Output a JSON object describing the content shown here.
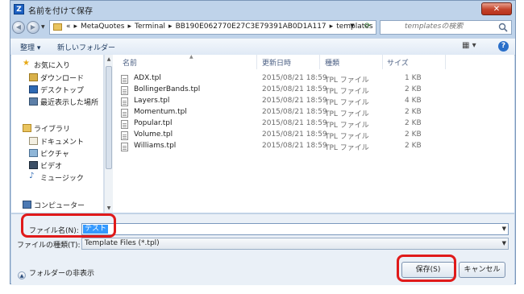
{
  "window": {
    "title": "名前を付けて保存",
    "app_icon": "Z",
    "close_glyph": "✕"
  },
  "address": {
    "crumbs": [
      "«",
      "MetaQuotes",
      "Terminal",
      "BB190E062770E27C3E79391AB0D1A117",
      "templates"
    ],
    "separator": "▸",
    "search_placeholder": "templatesの検索"
  },
  "toolbar": {
    "organize": "整理 ▾",
    "new_folder": "新しいフォルダー",
    "views_icon": "▦ ▾",
    "help": "?"
  },
  "sidebar": {
    "items": [
      {
        "label": "お気に入り",
        "icon": "star-icon"
      },
      {
        "label": "ダウンロード",
        "icon": "download-icon"
      },
      {
        "label": "デスクトップ",
        "icon": "desktop-icon"
      },
      {
        "label": "最近表示した場所",
        "icon": "recent-places-icon"
      },
      {
        "label": "ライブラリ",
        "icon": "library-icon"
      },
      {
        "label": "ドキュメント",
        "icon": "documents-icon"
      },
      {
        "label": "ピクチャ",
        "icon": "pictures-icon"
      },
      {
        "label": "ビデオ",
        "icon": "videos-icon"
      },
      {
        "label": "ミュージック",
        "icon": "music-icon"
      },
      {
        "label": "コンピューター",
        "icon": "computer-icon"
      }
    ]
  },
  "files": {
    "columns": [
      "名前",
      "更新日時",
      "種類",
      "サイズ"
    ],
    "rows": [
      {
        "name": "ADX.tpl",
        "modified": "2015/08/21 18:59",
        "type": "TPL ファイル",
        "size": "1 KB"
      },
      {
        "name": "BollingerBands.tpl",
        "modified": "2015/08/21 18:59",
        "type": "TPL ファイル",
        "size": "2 KB"
      },
      {
        "name": "Layers.tpl",
        "modified": "2015/08/21 18:59",
        "type": "TPL ファイル",
        "size": "4 KB"
      },
      {
        "name": "Momentum.tpl",
        "modified": "2015/08/21 18:59",
        "type": "TPL ファイル",
        "size": "2 KB"
      },
      {
        "name": "Popular.tpl",
        "modified": "2015/08/21 18:59",
        "type": "TPL ファイル",
        "size": "2 KB"
      },
      {
        "name": "Volume.tpl",
        "modified": "2015/08/21 18:59",
        "type": "TPL ファイル",
        "size": "2 KB"
      },
      {
        "name": "Williams.tpl",
        "modified": "2015/08/21 18:59",
        "type": "TPL ファイル",
        "size": "2 KB"
      }
    ]
  },
  "form": {
    "filename_label": "ファイル名(N):",
    "filename_value": "テスト",
    "filetype_label": "ファイルの種類(T):",
    "filetype_value": "Template Files (*.tpl)"
  },
  "footer": {
    "hide_folders": "フォルダーの非表示",
    "save": "保存(S)",
    "cancel": "キャンセル"
  },
  "colors": {
    "highlight": "#e01a1a",
    "selection": "#3399ff",
    "frame": "#bfd3ea"
  }
}
